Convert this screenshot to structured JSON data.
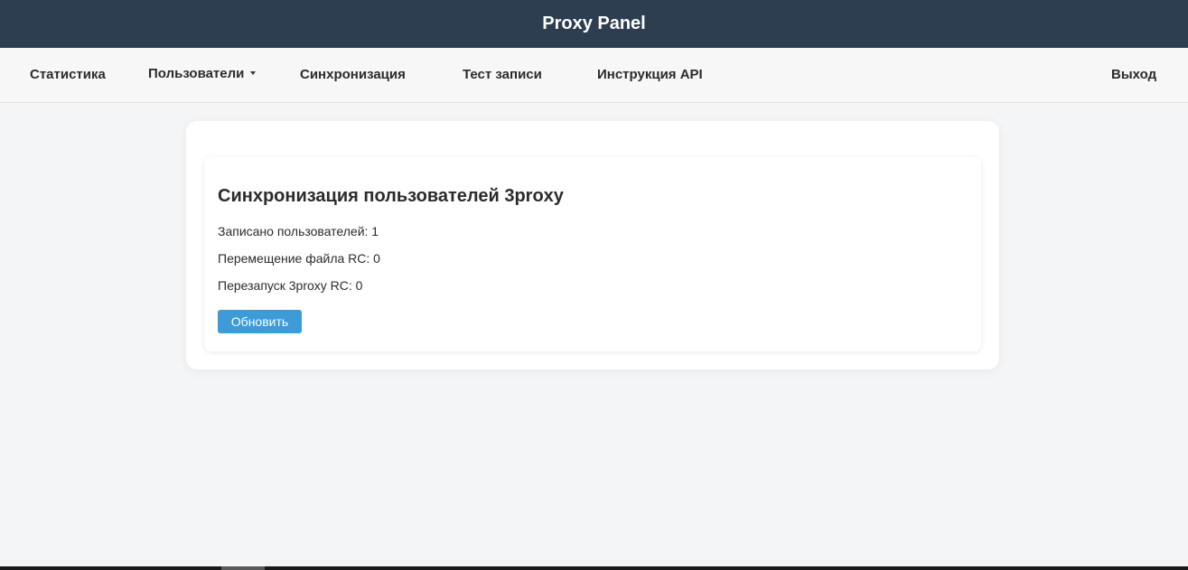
{
  "header": {
    "title": "Proxy Panel",
    "background": "#2d3e50"
  },
  "nav": {
    "items": [
      {
        "label": "Статистика"
      },
      {
        "label": "Пользователи",
        "has_dropdown": true
      },
      {
        "label": "Синхронизация"
      },
      {
        "label": "Тест записи"
      },
      {
        "label": "Инструкция API"
      }
    ],
    "logout_label": "Выход"
  },
  "sync": {
    "title": "Синхронизация пользователей 3proxy",
    "users_written": "Записано пользователей: 1",
    "rc_move_file": "Перемещение файла RC: 0",
    "rc_restart": "Перезапуск 3proxy RC: 0",
    "refresh_label": "Обновить",
    "button_color": "#3d9bd8"
  }
}
